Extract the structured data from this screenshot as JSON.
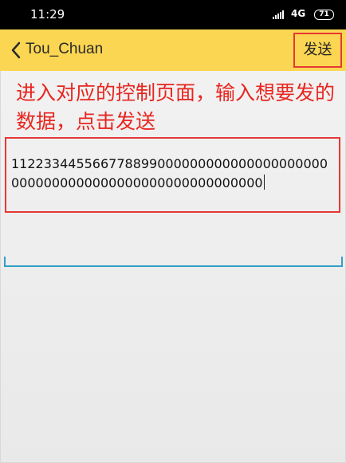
{
  "status_bar": {
    "time": "11:29",
    "network": "4G",
    "battery": "71",
    "icons": [
      "signal-icon",
      "battery-icon"
    ]
  },
  "app_bar": {
    "back_icon": "chevron-left-icon",
    "title": "Tou_Chuan",
    "send_label": "发送",
    "background": "#fbd652"
  },
  "annotation": {
    "text": "进入对应的控制页面，输入想要发的数据，点击发送",
    "color": "#e8251f"
  },
  "message_input": {
    "value": "1122334455667788990000000000000000000000000000000000000000000000000000"
  },
  "colors": {
    "highlight_border": "#e53935",
    "input_underline": "#2fa0c6"
  }
}
